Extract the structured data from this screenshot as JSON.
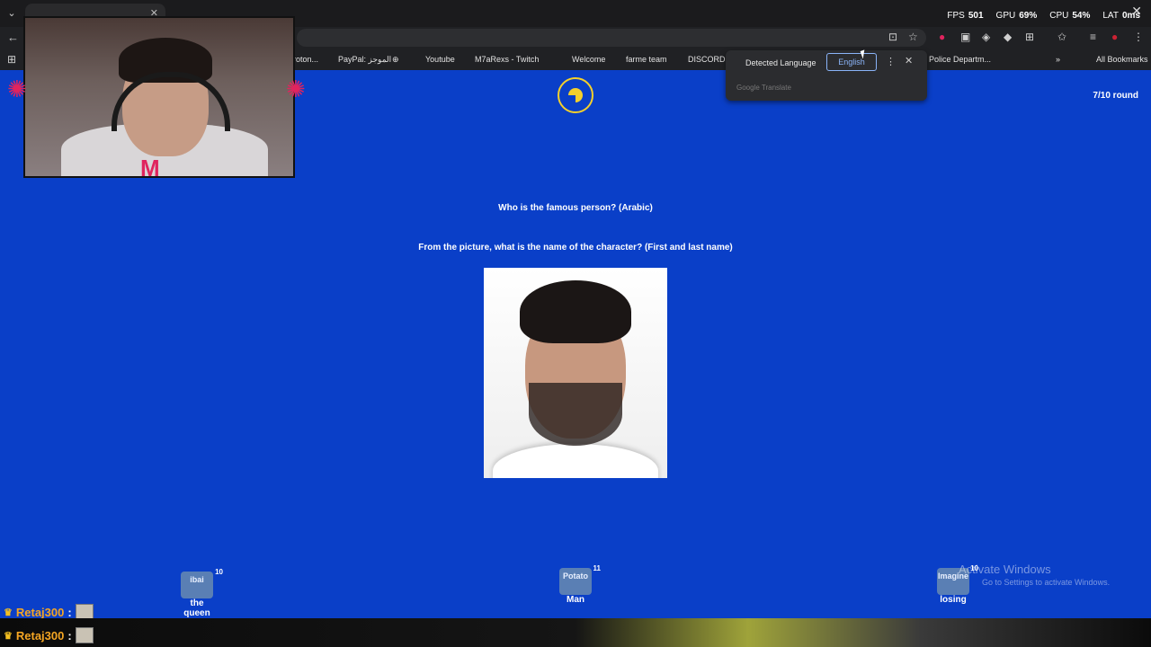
{
  "browser": {
    "back_icon": "←",
    "tab_close": "✕",
    "window_close": "✕",
    "toolbar_icons": [
      "translate-icon",
      "star-icon",
      "extension-icon",
      "screenshot-icon",
      "shield-icon",
      "diamond-icon",
      "puzzle-icon",
      "bookmark-star-icon",
      "media-icon",
      "profile-icon",
      "menu-icon"
    ],
    "bookmarks": [
      {
        "label": "roton..."
      },
      {
        "label": "PayPal: الموجز"
      },
      {
        "label": "Youtube"
      },
      {
        "label": "M7aRexs - Twitch"
      },
      {
        "label": "Welcome"
      },
      {
        "label": "farme team"
      },
      {
        "label": "DISCORD"
      },
      {
        "label": "Police Departm..."
      },
      {
        "label": "All Bookmarks"
      }
    ]
  },
  "performance": {
    "fps_label": "FPS",
    "fps_value": "501",
    "gpu_label": "GPU",
    "gpu_value": "69%",
    "cpu_label": "CPU",
    "cpu_value": "54%",
    "lat_label": "LAT",
    "lat_value": "0ms"
  },
  "translate_popup": {
    "detected_label": "Detected Language",
    "target_language": "English",
    "more_icon": "⋮",
    "close_icon": "✕",
    "brand": "Google Translate"
  },
  "game": {
    "round": "7/10",
    "round_label": "round",
    "question_title": "Who is the famous person? (Arabic)",
    "question_subtitle": "From the picture, what is the name of the character? (First and last name)"
  },
  "players": [
    {
      "name": "the queen",
      "score": "10",
      "avatar_text": "ibai"
    },
    {
      "name": "Man",
      "score": "11",
      "avatar_text": "Potato"
    },
    {
      "name": "losing",
      "score": "10",
      "avatar_text": "Imagine"
    }
  ],
  "watermark": {
    "line1": "Activate Windows",
    "line2": "Go to Settings to activate Windows."
  },
  "chat": [
    {
      "user": "Retaj300",
      "sep": ":"
    },
    {
      "user": "Retaj300",
      "sep": ":"
    }
  ]
}
